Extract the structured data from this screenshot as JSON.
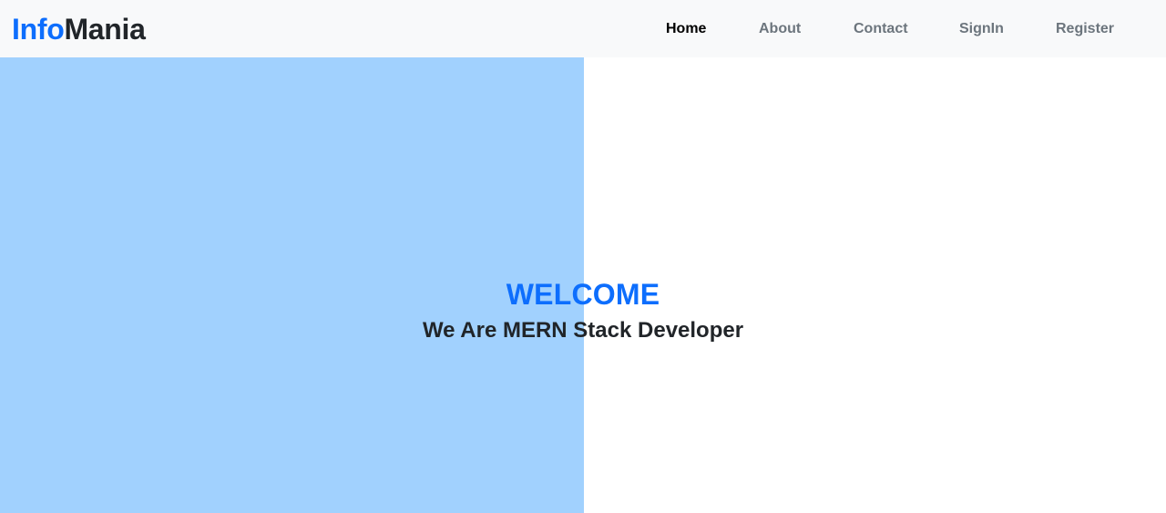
{
  "navbar": {
    "brand": {
      "part1": "Info",
      "part2": "Mania",
      "part1_color": "#0d6efd",
      "part2_color": "#212529"
    },
    "links": [
      {
        "label": "Home",
        "active": true
      },
      {
        "label": "About",
        "active": false
      },
      {
        "label": "Contact",
        "active": false
      },
      {
        "label": "SignIn",
        "active": false
      },
      {
        "label": "Register",
        "active": false
      }
    ]
  },
  "hero": {
    "title": "WELCOME",
    "subtitle": "We Are MERN Stack Developer",
    "panel_color": "#a1d1fe",
    "title_color": "#0d6efd"
  }
}
